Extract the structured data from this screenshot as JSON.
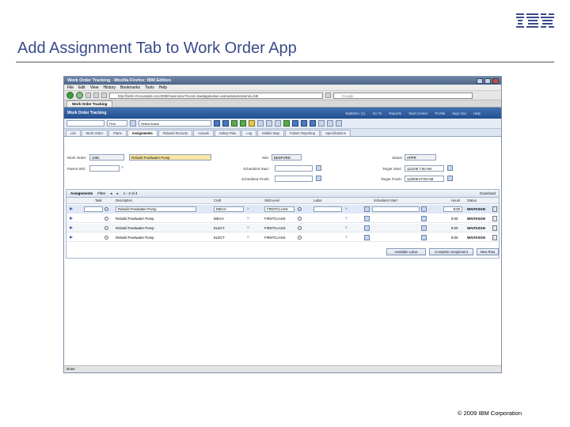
{
  "slide": {
    "title": "Add Assignment Tab to Work Order App",
    "logo_text": "IBM",
    "copyright": "© 2009 IBM Corporation"
  },
  "browser": {
    "window_title": "Work Order Tracking - Mozilla Firefox: IBM Edition",
    "menu": [
      "File",
      "Edit",
      "View",
      "History",
      "Bookmarks",
      "Tools",
      "Help"
    ],
    "url": "http://berlin-02.example.com:9080/maximo/ui/?event=loadapp&value=wotrack&uisessionid=348",
    "search_placeholder": "Google",
    "tab_title": "Work Order Tracking",
    "status": "Done"
  },
  "app": {
    "name": "Work Order Tracking",
    "header_links": [
      "Bulletins: (1)",
      "Go To",
      "Reports",
      "Start Center",
      "Profile",
      "Sign Out",
      "Help"
    ],
    "toolbar": {
      "select_value": "Find",
      "action_value": "Select Action"
    },
    "tabs": [
      "List",
      "Work Order",
      "Plans",
      "Assignments",
      "Related Records",
      "Actuals",
      "Safety Plan",
      "Log",
      "Mobile Map",
      "Failure Reporting",
      "Specifications"
    ],
    "active_tab": "Assignments"
  },
  "form": {
    "work_order_label": "Work Order:",
    "work_order_value": "1092",
    "work_order_desc": "Rebuild Feedwater Pump",
    "parent_label": "Parent WO:",
    "parent_value": "",
    "site_label": "Site:",
    "site_value": "BEDFORD",
    "status_label": "Status:",
    "status_value": "APPR",
    "sched_start_label": "Scheduled Start:",
    "sched_start_value": "",
    "target_start_label": "Target Start:",
    "target_start_value": "11/1/08 7:00 AM",
    "sched_finish_label": "Scheduled Finish:",
    "sched_finish_value": "",
    "target_finish_label": "Target Finish:",
    "target_finish_value": "11/5/08 07:00 AM"
  },
  "assignments": {
    "title": "Assignments",
    "filter_label": "Filter",
    "pagination": "1 - 4 of 4",
    "download_label": "Download",
    "columns": [
      "Task",
      "Description",
      "Craft",
      "Skill Level",
      "Labor",
      "Scheduled Start",
      "Hours",
      "Status"
    ],
    "rows": [
      {
        "task": "",
        "description": "Rebuild Feedwater Pump",
        "craft": "MECH",
        "skill": "FIRSTCLASS",
        "labor": "",
        "hours": "8:00",
        "status": "WAITASGN"
      },
      {
        "task": "",
        "description": "Rebuild Feedwater Pump",
        "craft": "MECH",
        "skill": "FIRSTCLASS",
        "labor": "",
        "hours": "8:00",
        "status": "WAITASGN"
      },
      {
        "task": "",
        "description": "Rebuild Feedwater Pump",
        "craft": "ELECT",
        "skill": "FIRSTCLASS",
        "labor": "",
        "hours": "8:00",
        "status": "WAITASGN"
      },
      {
        "task": "",
        "description": "Rebuild Feedwater Pump",
        "craft": "ELECT",
        "skill": "FIRSTCLASS",
        "labor": "",
        "hours": "8:00",
        "status": "WAITASGN"
      }
    ],
    "buttons": {
      "available_labor": "Available Labor",
      "complete_assignment": "Complete Assignment",
      "new_row": "New Row"
    }
  }
}
